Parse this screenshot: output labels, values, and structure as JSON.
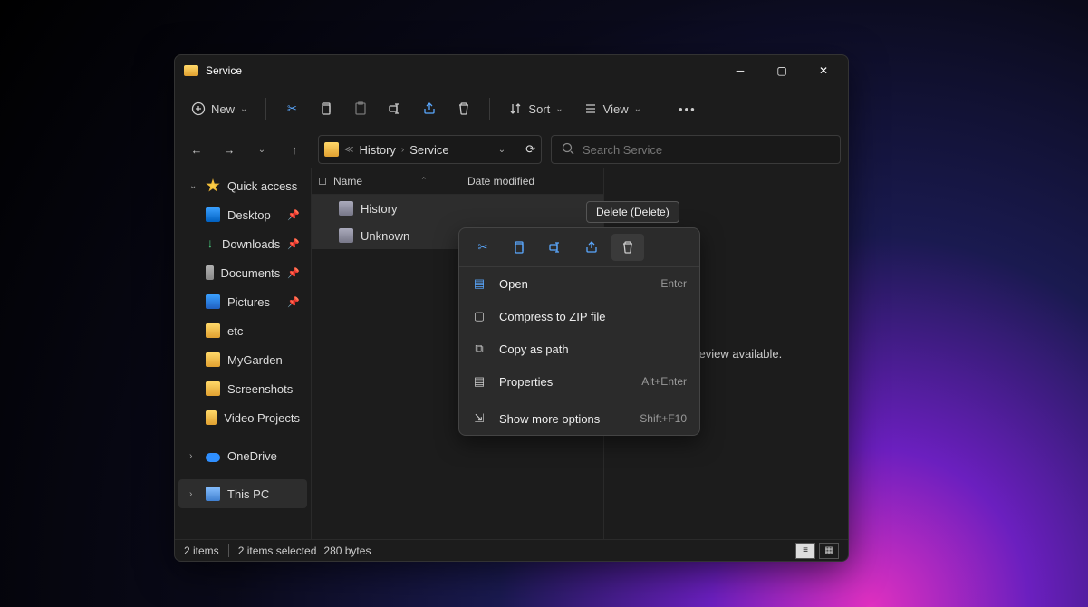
{
  "window": {
    "title": "Service"
  },
  "toolbar": {
    "new": "New",
    "sort": "Sort",
    "view": "View"
  },
  "breadcrumb": {
    "p1": "History",
    "p2": "Service"
  },
  "search": {
    "placeholder": "Search Service"
  },
  "columns": {
    "name": "Name",
    "date": "Date modified"
  },
  "sidebar": {
    "quick": "Quick access",
    "desktop": "Desktop",
    "downloads": "Downloads",
    "documents": "Documents",
    "pictures": "Pictures",
    "etc": "etc",
    "mygarden": "MyGarden",
    "screenshots": "Screenshots",
    "videoproj": "Video Projects",
    "onedrive": "OneDrive",
    "thispc": "This PC"
  },
  "files": {
    "f1": "History",
    "f2": "Unknown"
  },
  "preview": {
    "text": "No preview available."
  },
  "status": {
    "count": "2 items",
    "sel": "2 items selected",
    "size": "280 bytes"
  },
  "tooltip": {
    "text": "Delete (Delete)"
  },
  "ctx": {
    "open": "Open",
    "open_s": "Enter",
    "zip": "Compress to ZIP file",
    "copy": "Copy as path",
    "prop": "Properties",
    "prop_s": "Alt+Enter",
    "more": "Show more options",
    "more_s": "Shift+F10"
  }
}
